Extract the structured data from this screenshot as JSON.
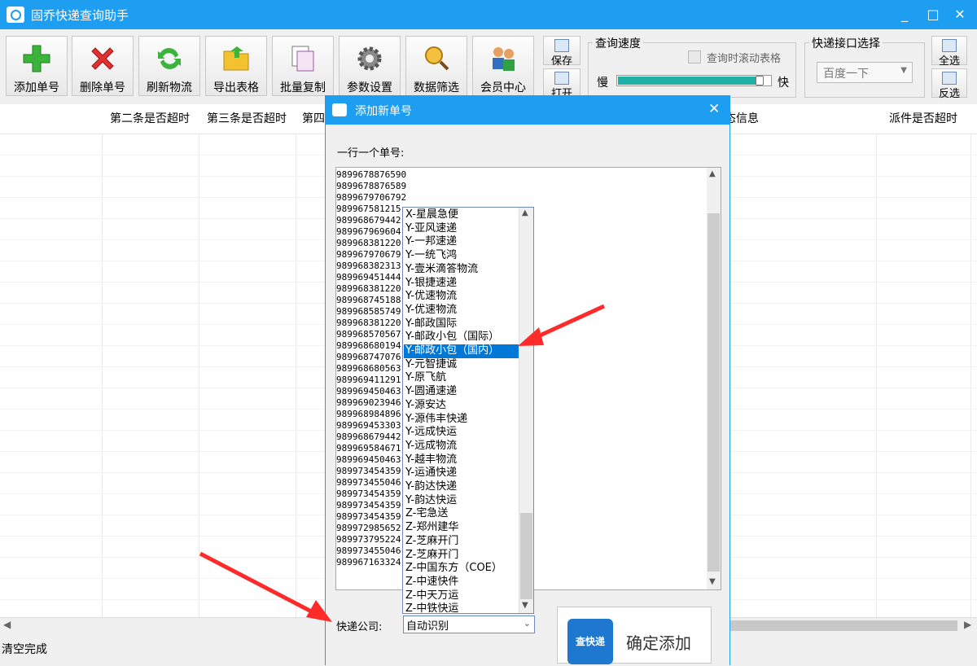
{
  "window": {
    "title": "固乔快递查询助手",
    "minimize": "_",
    "maximize": "□",
    "close": "✕"
  },
  "toolbar": {
    "buttons": [
      {
        "label": "添加单号"
      },
      {
        "label": "删除单号"
      },
      {
        "label": "刷新物流"
      },
      {
        "label": "导出表格"
      },
      {
        "label": "批量复制"
      },
      {
        "label": "参数设置"
      },
      {
        "label": "数据筛选"
      },
      {
        "label": "会员中心"
      }
    ],
    "save_label": "保存",
    "open_label": "打开",
    "speed": {
      "title": "查询速度",
      "scroll_checkbox": "查询时滚动表格",
      "slow": "慢",
      "fast": "快",
      "value_percent": 95
    },
    "api": {
      "title": "快递接口选择",
      "selected": "百度一下"
    },
    "select_all": "全选",
    "invert": "反选"
  },
  "table": {
    "headers": [
      "第二条是否超时",
      "第三条是否超时",
      "第四",
      "态信息",
      "派件是否超时"
    ]
  },
  "status": {
    "text": "清空完成"
  },
  "dialog": {
    "title": "添加新单号",
    "close": "✕",
    "prompt": "一行一个单号:",
    "tracking_numbers": "9899678876590\n9899678876589\n9899679706792\n98996758121​5\n98996867944​2\n98996796960​4\n98996838122​0\n98996797067​9\n98996838231​3\n98996945144​4\n98996838122​0\n98996874518​8\n98996858574​9\n98996838122​0\n98996857056​7\n98996868019​4\n98996874707​6\n98996868056​3\n98996941129​1\n98996945046​3\n98996902394​6\n98996898489​6\n98996945330​3\n98996867944​2\n98996958467​1\n98996945046​3\n98997345435​9\n98997345504​6\n98997345435​9\n98997345435​9\n98997345435​9\n98997298565​2\n98997379522​4\n98997345504​6\n98996716332​4",
    "company_label": "快递公司:",
    "company_selected": "自动识别",
    "confirm_label": "确定添加",
    "confirm_logo": "查快递",
    "options": [
      "X-星晨急便",
      "Y-亚风速递",
      "Y-一邦速递",
      "Y-一统飞鸿",
      "Y-壹米滴答物流",
      "Y-银捷速递",
      "Y-优速物流",
      "Y-优速物流",
      "Y-邮政国际",
      "Y-邮政小包（国际）",
      "Y-邮政小包（国内）",
      "Y-元智捷诚",
      "Y-原飞航",
      "Y-圆通速递",
      "Y-源安达",
      "Y-源伟丰快递",
      "Y-远成快运",
      "Y-远成物流",
      "Y-越丰物流",
      "Y-运通快递",
      "Y-韵达快递",
      "Y-韵达快运",
      "Z-宅急送",
      "Z-郑州建华",
      "Z-芝麻开门",
      "Z-芝麻开门",
      "Z-中国东方（COE）",
      "Z-中速快件",
      "Z-中天万运",
      "Z-中铁快运"
    ],
    "selected_index": 10
  }
}
